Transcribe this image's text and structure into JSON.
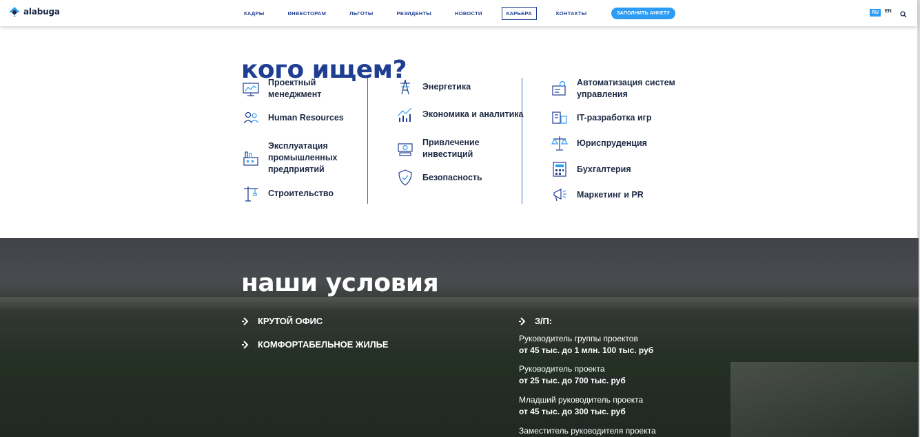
{
  "header": {
    "logo_text": "alabuga",
    "nav": [
      "КАДРЫ",
      "ИНВЕСТОРАМ",
      "ЛЬГОТЫ",
      "РЕЗИДЕНТЫ",
      "НОВОСТИ",
      "КАРЬЕРА",
      "КОНТАКТЫ"
    ],
    "active_nav": "КАРЬЕРА",
    "cta_label": "ЗАПОЛНИТЬ АНКЕТУ",
    "lang_ru": "RU",
    "lang_en": "EN"
  },
  "who_section": {
    "title": "кого ищем?",
    "columns": [
      [
        {
          "label": "Проектный менеджмент",
          "icon": "monitor-chart-icon"
        },
        {
          "label": "Human Resources",
          "icon": "people-icon"
        },
        {
          "label": "Эксплуатация промышленных предприятий",
          "icon": "factory-icon"
        },
        {
          "label": "Строительство",
          "icon": "crane-icon"
        }
      ],
      [
        {
          "label": "Энергетика",
          "icon": "power-tower-icon"
        },
        {
          "label": "Экономика и аналитика",
          "icon": "analytics-chart-icon"
        },
        {
          "label": "Привлечение инвестиций",
          "icon": "money-icon"
        },
        {
          "label": "Безопасность",
          "icon": "shield-icon"
        }
      ],
      [
        {
          "label": "Автоматизация систем управления",
          "icon": "automation-icon"
        },
        {
          "label": "IT-разработка игр",
          "icon": "game-dev-icon"
        },
        {
          "label": "Юриспруденция",
          "icon": "scales-icon"
        },
        {
          "label": "Бухгалтерия",
          "icon": "calculator-icon"
        },
        {
          "label": "Маркетинг и PR",
          "icon": "megaphone-icon"
        }
      ]
    ]
  },
  "conditions_section": {
    "title": "наши условия",
    "items": [
      "КРУТОЙ ОФИС",
      "КОМФОРТАБЕЛЬНОЕ ЖИЛЬЕ"
    ],
    "salary_heading": "З/П:",
    "salaries": [
      {
        "position": "Руководитель группы проектов",
        "range": "от 45 тыс. до 1 млн. 100 тыс. руб"
      },
      {
        "position": "Руководитель проекта",
        "range": "от 25 тыс. до 700 тыс. руб"
      },
      {
        "position": "Младший руководитель проекта",
        "range": "от 45 тыс. до 300 тыс. руб"
      },
      {
        "position": "Заместитель руководителя проекта",
        "range": ""
      }
    ]
  },
  "colors": {
    "brand_blue": "#1f3e91",
    "cta_blue": "#2d9cf5",
    "text_dark": "#1d2a45"
  }
}
